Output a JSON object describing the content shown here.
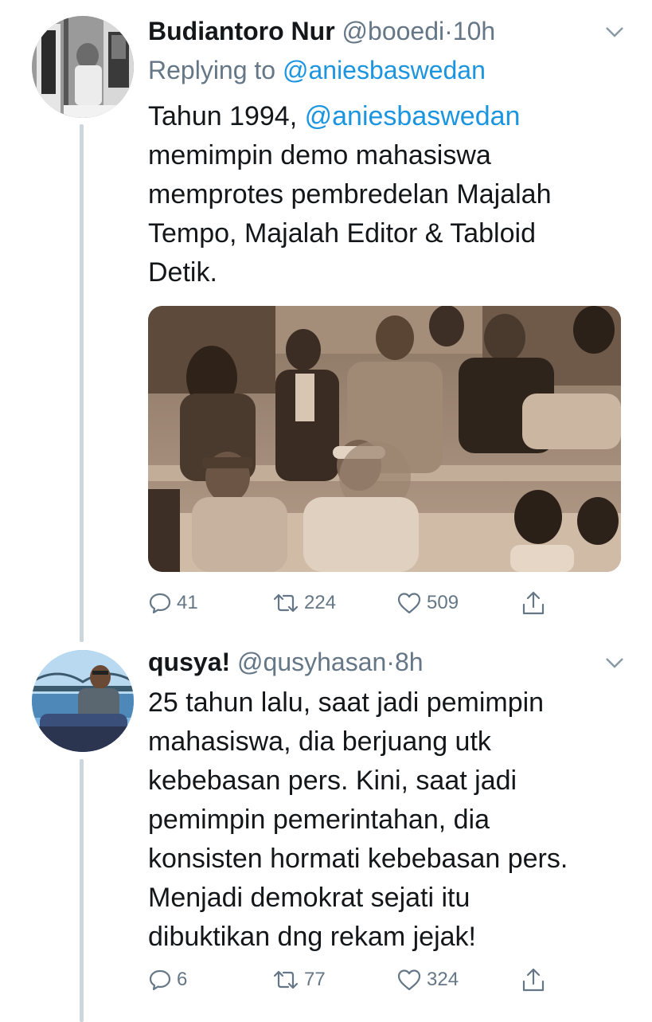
{
  "tweets": [
    {
      "name": "Budiantoro Nur",
      "handle": "@booedi",
      "separator": "·",
      "time": "10h",
      "replying_label": "Replying to",
      "replying_to": "@aniesbaswedan",
      "text_prefix": "Tahun 1994, ",
      "text_mention": "@aniesbaswedan",
      "text_lines": [
        "memimpin demo mahasiswa",
        "memprotes pembredelan Majalah",
        "Tempo, Majalah Editor & Tabloid",
        "Detik."
      ],
      "replies": "41",
      "retweets": "224",
      "likes": "509"
    },
    {
      "name": "qusya!",
      "handle": "@qusyhasan",
      "separator": "·",
      "time": "8h",
      "text_lines": [
        "25 tahun lalu, saat jadi pemimpin",
        "mahasiswa, dia berjuang utk",
        "kebebasan pers. Kini, saat jadi",
        "pemimpin pemerintahan, dia",
        "konsisten hormati kebebasan pers.",
        "Menjadi demokrat sejati itu",
        "dibuktikan dng rekam jejak!"
      ],
      "replies": "6",
      "retweets": "77",
      "likes": "324"
    }
  ],
  "icons": {
    "reply": "reply-icon",
    "retweet": "retweet-icon",
    "like": "heart-icon",
    "share": "share-icon",
    "more": "chevron-down-icon"
  },
  "colors": {
    "text": "#14171a",
    "secondary": "#657786",
    "link": "#1b95e0",
    "thread_line": "#cdd6dd"
  }
}
